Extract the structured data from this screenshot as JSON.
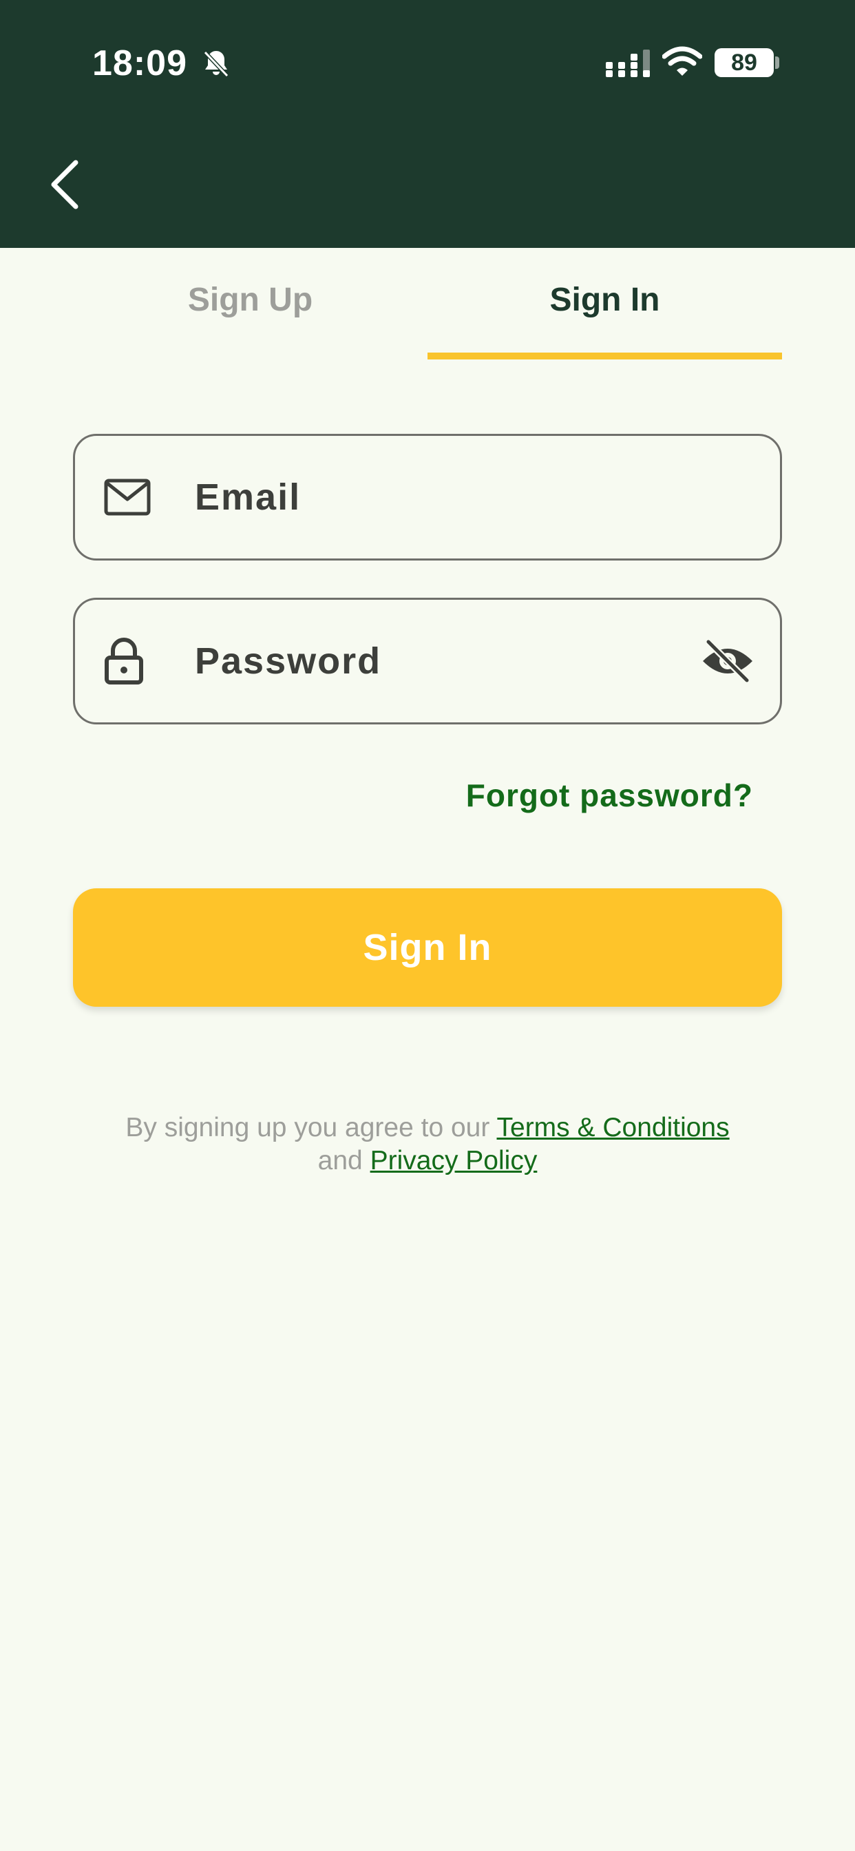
{
  "status_bar": {
    "time": "18:09",
    "battery": "89",
    "icons": [
      "bell-slash-icon",
      "cellular-signal-icon",
      "wifi-icon",
      "battery-icon"
    ]
  },
  "header": {
    "back_icon": "chevron-left-icon",
    "background_color": "#1d3a2d"
  },
  "tabs": {
    "signup_label": "Sign Up",
    "signin_label": "Sign In",
    "active": "Sign In",
    "active_color": "#1d3a2d",
    "inactive_color": "#9d9e9a",
    "underline_color": "#f9c42d"
  },
  "form": {
    "email": {
      "placeholder": "Email",
      "icon": "envelope-icon",
      "value": ""
    },
    "password": {
      "placeholder": "Password",
      "icon": "lock-icon",
      "toggle_icon": "eye-slash-icon",
      "value": ""
    },
    "forgot_label": "Forgot password?",
    "link_color": "#146b1a",
    "submit_label": "Sign In",
    "submit_color": "#fec42a"
  },
  "legal": {
    "prefix": "By signing up you agree to our",
    "terms_label": "Terms & Conditions",
    "conjunction": "and",
    "privacy_label": "Privacy Policy"
  }
}
